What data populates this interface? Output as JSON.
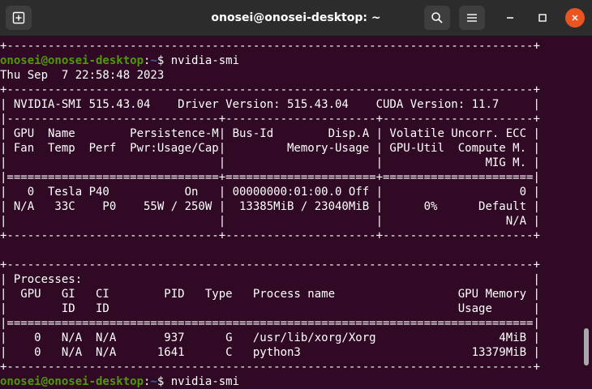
{
  "window": {
    "title": "onosei@onosei-desktop: ~"
  },
  "prompt": {
    "user_host": "onosei@onosei-desktop",
    "sep": ":",
    "path": "~",
    "dollar": "$ ",
    "command": "nvidia-smi"
  },
  "output_lines": [
    "+-----------------------------------------------------------------------------+",
    null,
    "Thu Sep  7 22:58:48 2023",
    "+-----------------------------------------------------------------------------+",
    "| NVIDIA-SMI 515.43.04    Driver Version: 515.43.04    CUDA Version: 11.7     |",
    "|-------------------------------+----------------------+----------------------+",
    "| GPU  Name        Persistence-M| Bus-Id        Disp.A | Volatile Uncorr. ECC |",
    "| Fan  Temp  Perf  Pwr:Usage/Cap|         Memory-Usage | GPU-Util  Compute M. |",
    "|                               |                      |               MIG M. |",
    "|===============================+======================+======================|",
    "|   0  Tesla P40           On   | 00000000:01:00.0 Off |                    0 |",
    "| N/A   33C    P0    55W / 250W |  13385MiB / 23040MiB |      0%      Default |",
    "|                               |                      |                  N/A |",
    "+-------------------------------+----------------------+----------------------+",
    "",
    "+-----------------------------------------------------------------------------+",
    "| Processes:                                                                  |",
    "|  GPU   GI   CI        PID   Type   Process name                  GPU Memory |",
    "|        ID   ID                                                   Usage      |",
    "|=============================================================================|",
    "|    0   N/A  N/A       937      G   /usr/lib/xorg/Xorg                  4MiB |",
    "|    0   N/A  N/A      1641      C   python3                         13379MiB |",
    "+-----------------------------------------------------------------------------+",
    null
  ],
  "icons": {
    "new_tab": "new-tab-icon",
    "search": "search-icon",
    "menu": "hamburger-menu-icon",
    "minimize": "minimize-icon",
    "maximize": "maximize-icon",
    "close": "close-icon"
  },
  "colors": {
    "terminal_bg": "#300a24",
    "titlebar_bg": "#2c2c2c",
    "prompt_user": "#4e9a06",
    "prompt_path": "#3465a4",
    "close_button": "#e95420"
  }
}
